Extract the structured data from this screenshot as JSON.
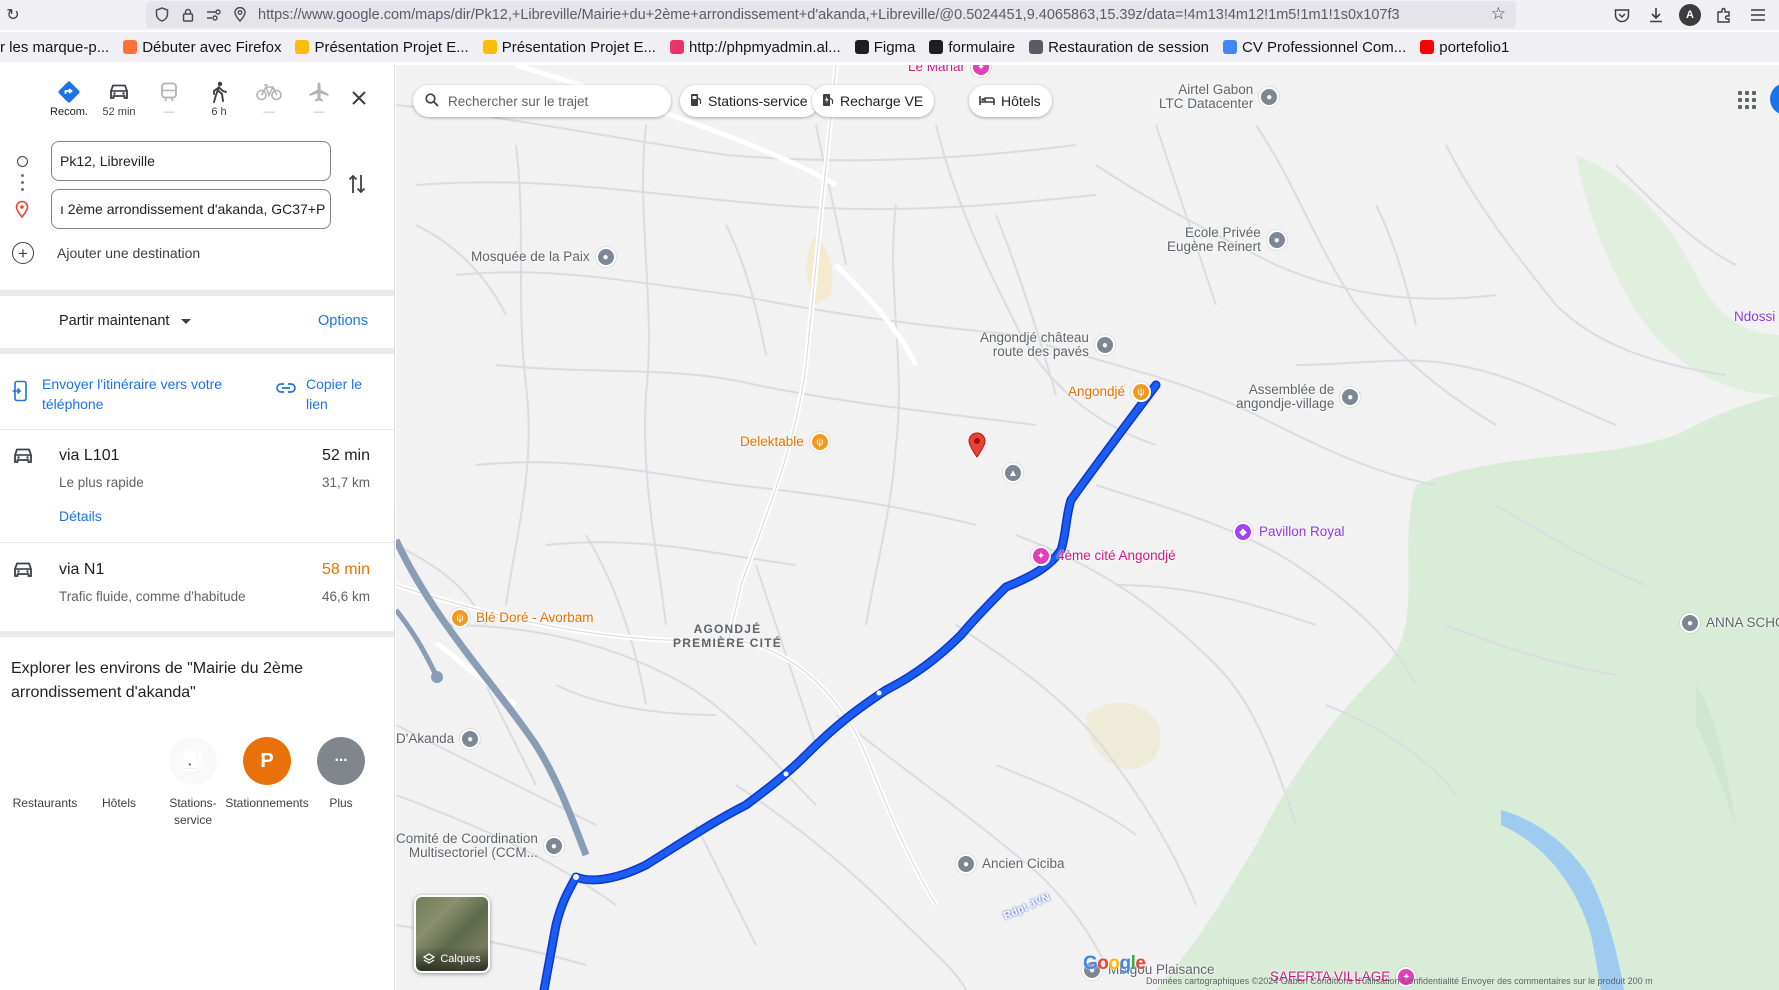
{
  "browser": {
    "url": "https://www.google.com/maps/dir/Pk12,+Libreville/Mairie+du+2ème+arrondissement+d'akanda,+Libreville/@0.5024451,9.4065863,15.39z/data=!4m13!4m12!1m5!1m1!1s0x107f3",
    "bookmarks": [
      {
        "label": "r les marque-p...",
        "color": "#ffffff"
      },
      {
        "label": "Débuter avec Firefox",
        "color": "#ff7139"
      },
      {
        "label": "Présentation Projet E...",
        "color": "#fbbc04"
      },
      {
        "label": "Présentation Projet E...",
        "color": "#fbbc04"
      },
      {
        "label": "http://phpmyadmin.al...",
        "color": "#e8336b"
      },
      {
        "label": "Figma",
        "color": "#1e1e1e"
      },
      {
        "label": "formulaire",
        "color": "#1e1e1e"
      },
      {
        "label": "Restauration de session",
        "color": "#5b5b66"
      },
      {
        "label": "CV Professionnel Com...",
        "color": "#4285f4"
      },
      {
        "label": "portefolio1",
        "color": "#ff0000"
      }
    ],
    "profile_initial": "A"
  },
  "directions": {
    "modes": [
      {
        "icon": "directions-icon",
        "label": "Recom.",
        "state": "selected"
      },
      {
        "icon": "car-icon",
        "label": "52 min",
        "state": "normal"
      },
      {
        "icon": "train-icon",
        "label": "—",
        "state": "disabled"
      },
      {
        "icon": "walk-icon",
        "label": "6 h",
        "state": "normal"
      },
      {
        "icon": "bike-icon",
        "label": "—",
        "state": "disabled"
      },
      {
        "icon": "plane-icon",
        "label": "—",
        "state": "disabled"
      }
    ],
    "origin": "Pk12, Libreville",
    "destination": "ı 2ème arrondissement d'akanda, GC37+P",
    "add_destination": "Ajouter une destination",
    "depart_label": "Partir maintenant",
    "options_label": "Options",
    "send_to_phone": "Envoyer l'itinéraire vers votre téléphone",
    "copy_link": "Copier le lien",
    "routes": [
      {
        "name": "via L101",
        "time": "52 min",
        "time_color": "#202124",
        "subtitle": "Le plus rapide",
        "distance": "31,7 km",
        "details": "Détails"
      },
      {
        "name": "via N1",
        "time": "58 min",
        "time_color": "#e37400",
        "subtitle": "Trafic fluide, comme d'habitude",
        "distance": "46,6 km",
        "details": ""
      }
    ],
    "explore_title": "Explorer les environs de \"Mairie du 2ème arrondissement d'akanda\"",
    "explore_categories": [
      {
        "label": "Restaurants",
        "color": "#188038",
        "icon": "fork-knife-icon"
      },
      {
        "label": "Hôtels",
        "color": "#12b5cb",
        "icon": "bed-icon"
      },
      {
        "label": "Stations-service",
        "color": "#d93025",
        "icon": "fuel-icon"
      },
      {
        "label": "Stationnements",
        "color": "#e8710a",
        "icon": "parking-icon"
      },
      {
        "label": "Plus",
        "color": "#80868b",
        "icon": "more-icon"
      }
    ]
  },
  "map": {
    "search_placeholder": "Rechercher sur le trajet",
    "chips": [
      "Stations-service",
      "Recharge VE",
      "Hôtels"
    ],
    "pois": [
      {
        "label": "Le Manar",
        "style": "pink"
      },
      {
        "label": "Airtel Gabon\nLTC Datacenter",
        "style": "grey"
      },
      {
        "label": "Mosquée de la Paix",
        "style": "grey"
      },
      {
        "label": "Ecole Privée\nEugène Reinert",
        "style": "grey"
      },
      {
        "label": "Ndossi",
        "style": "purple"
      },
      {
        "label": "Angondjé château\nroute des pavés",
        "style": "grey"
      },
      {
        "label": "Angondjé",
        "style": "orange"
      },
      {
        "label": "Assemblée de\nangondje-village",
        "style": "grey"
      },
      {
        "label": "Delektable",
        "style": "orange"
      },
      {
        "label": "4ème cité Angondjé",
        "style": "pink"
      },
      {
        "label": "Pavillon Royal",
        "style": "purple"
      },
      {
        "label": "ANNA SCHO",
        "style": "grey"
      },
      {
        "label": "Blé Doré - Avorbam",
        "style": "orange"
      },
      {
        "label": "D'Akanda",
        "style": "grey"
      },
      {
        "label": "Comité de Coordination\nMultisectoriel (CCM...",
        "style": "grey"
      },
      {
        "label": "Ancien Ciciba",
        "style": "grey"
      },
      {
        "label": "Mbigou Plaisance",
        "style": "grey"
      },
      {
        "label": "SAFERTA VILLAGE",
        "style": "pink"
      }
    ],
    "area_label": "AGONDJÉ\nPREMIÈRE CITÉ",
    "road_label": "Rdpt JVN",
    "layers_label": "Calques",
    "logo": "Google",
    "footer": "Données cartographiques ©2024   Gabon   Conditions d'utilisation   Confidentialité   Envoyer des commentaires sur le produit   200 m"
  }
}
